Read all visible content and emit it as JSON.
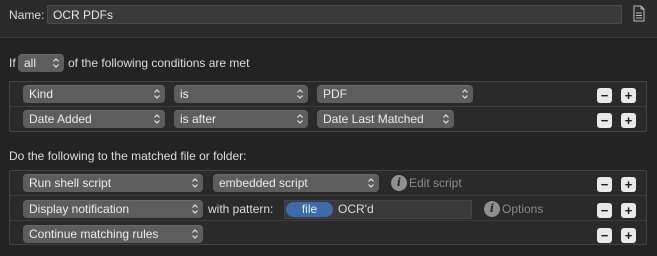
{
  "name_bar": {
    "label": "Name:",
    "value": "OCR PDFs",
    "icon": "document-icon"
  },
  "conditions": {
    "prefix": "If",
    "match_value": "all",
    "suffix": "of the following conditions are met",
    "rows": [
      {
        "attribute": "Kind",
        "operator": "is",
        "value": "PDF"
      },
      {
        "attribute": "Date Added",
        "operator": "is after",
        "value": "Date Last Matched"
      }
    ]
  },
  "actions": {
    "heading": "Do the following to the matched file or folder:",
    "rows": [
      {
        "action": "Run shell script",
        "option": "embedded script",
        "extra_label": "Edit script"
      },
      {
        "action": "Display notification",
        "pattern_label": "with pattern:",
        "token": "file",
        "pattern_text": "OCR'd",
        "extra_label": "Options"
      },
      {
        "action": "Continue matching rules"
      }
    ]
  },
  "buttons": {
    "remove": "−",
    "add": "+"
  },
  "colors": {
    "background": "#232323",
    "popup": "#5d5d5d",
    "token": "#3d6aa8",
    "button": "#e9e9e9"
  }
}
